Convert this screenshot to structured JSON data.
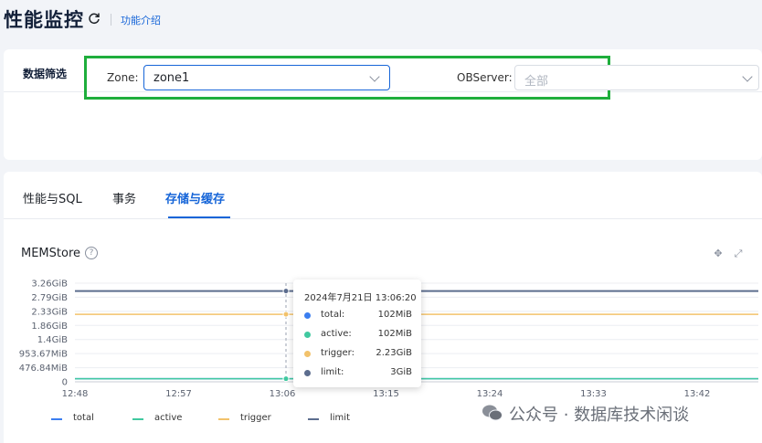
{
  "header": {
    "title": "性能监控",
    "intro_link": "功能介绍"
  },
  "filter": {
    "title": "数据筛选",
    "zone_label": "Zone:",
    "zone_value": "zone1",
    "observer_label": "OBServer:",
    "observer_placeholder": "全部"
  },
  "tabs": [
    {
      "label": "性能与SQL",
      "active": false
    },
    {
      "label": "事务",
      "active": false
    },
    {
      "label": "存储与缓存",
      "active": true
    }
  ],
  "chart": {
    "title": "MEMStore"
  },
  "chart_data": {
    "type": "line",
    "title": "MEMStore",
    "x": [
      "12:48",
      "12:57",
      "13:06",
      "13:15",
      "13:24",
      "13:33",
      "13:42"
    ],
    "y_tick_labels": [
      "0",
      "476.84MiB",
      "953.67MiB",
      "1.4GiB",
      "1.86GiB",
      "2.33GiB",
      "2.79GiB",
      "3.26GiB"
    ],
    "ylim_gib": [
      0,
      3.26
    ],
    "series": [
      {
        "name": "total",
        "color": "#3b7ef0",
        "value_gib": 0.1
      },
      {
        "name": "active",
        "color": "#41c9a0",
        "value_gib": 0.1
      },
      {
        "name": "trigger",
        "color": "#f2c26b",
        "value_gib": 2.23
      },
      {
        "name": "limit",
        "color": "#5c6d8e",
        "value_gib": 3.0
      }
    ],
    "tooltip": {
      "time": "2024年7月21日 13:06:20",
      "rows": [
        {
          "name": "total:",
          "value": "102MiB",
          "color": "#3b7ef0"
        },
        {
          "name": "active:",
          "value": "102MiB",
          "color": "#41c9a0"
        },
        {
          "name": "trigger:",
          "value": "2.23GiB",
          "color": "#f2c26b"
        },
        {
          "name": "limit:",
          "value": "3GiB",
          "color": "#5c6d8e"
        }
      ]
    },
    "legend": [
      "total",
      "active",
      "trigger",
      "limit"
    ],
    "grid": true
  },
  "watermark": "公众号 · 数据库技术闲谈"
}
